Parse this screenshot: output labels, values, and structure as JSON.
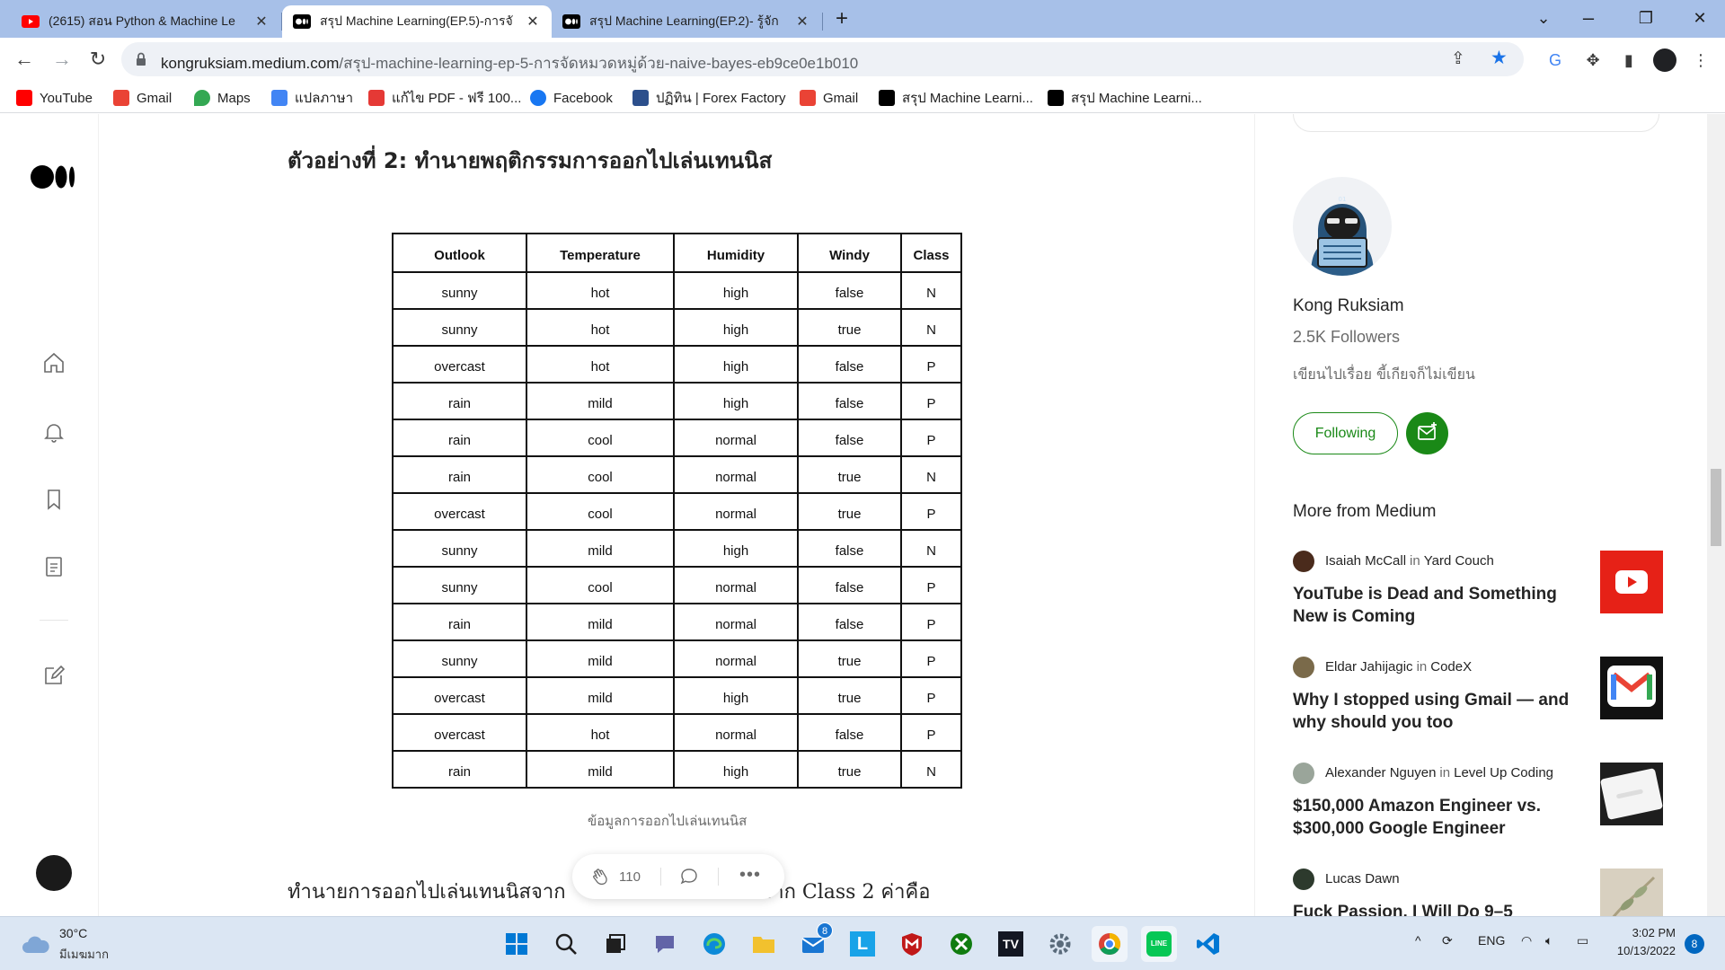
{
  "browser": {
    "tabs": [
      {
        "title": "(2615) สอน Python & Machine Le",
        "favicon": "youtube-icon",
        "active": false
      },
      {
        "title": "สรุป Machine Learning(EP.5)-การจั",
        "favicon": "medium-icon",
        "active": true
      },
      {
        "title": "สรุป Machine Learning(EP.2)- รู้จัก",
        "favicon": "medium-icon",
        "active": false
      }
    ],
    "url_host": "kongruksiam.medium.com",
    "url_path": "/สรุป-machine-learning-ep-5-การจัดหมวดหมู่ด้วย-naive-bayes-eb9ce0e1b010",
    "bookmarks": [
      {
        "label": "YouTube",
        "icon": "youtube-icon",
        "color": "#ff0000"
      },
      {
        "label": "Gmail",
        "icon": "gmail-icon",
        "color": "#ea4335"
      },
      {
        "label": "Maps",
        "icon": "maps-icon",
        "color": "#34a853"
      },
      {
        "label": "แปลภาษา",
        "icon": "translate-icon",
        "color": "#4285f4"
      },
      {
        "label": "แก้ไข PDF - ฟรี 100...",
        "icon": "pdf-icon",
        "color": "#e53935"
      },
      {
        "label": "Facebook",
        "icon": "facebook-icon",
        "color": "#1877f2"
      },
      {
        "label": "ปฏิทิน | Forex Factory",
        "icon": "calendar-icon",
        "color": "#2c4f8c"
      },
      {
        "label": "Gmail",
        "icon": "gmail-icon",
        "color": "#ea4335"
      },
      {
        "label": "สรุป Machine Learni...",
        "icon": "medium-icon",
        "color": "#000000"
      },
      {
        "label": "สรุป Machine Learni...",
        "icon": "medium-icon",
        "color": "#000000"
      }
    ]
  },
  "article": {
    "heading": "ตัวอย่างที่ 2: ทำนายพฤติกรรมการออกไปเล่นเทนนิส",
    "table_headers": [
      "Outlook",
      "Temperature",
      "Humidity",
      "Windy",
      "Class"
    ],
    "table_rows": [
      [
        "sunny",
        "hot",
        "high",
        "false",
        "N"
      ],
      [
        "sunny",
        "hot",
        "high",
        "true",
        "N"
      ],
      [
        "overcast",
        "hot",
        "high",
        "false",
        "P"
      ],
      [
        "rain",
        "mild",
        "high",
        "false",
        "P"
      ],
      [
        "rain",
        "cool",
        "normal",
        "false",
        "P"
      ],
      [
        "rain",
        "cool",
        "normal",
        "true",
        "N"
      ],
      [
        "overcast",
        "cool",
        "normal",
        "true",
        "P"
      ],
      [
        "sunny",
        "mild",
        "high",
        "false",
        "N"
      ],
      [
        "sunny",
        "cool",
        "normal",
        "false",
        "P"
      ],
      [
        "rain",
        "mild",
        "normal",
        "false",
        "P"
      ],
      [
        "sunny",
        "mild",
        "normal",
        "true",
        "P"
      ],
      [
        "overcast",
        "mild",
        "high",
        "true",
        "P"
      ],
      [
        "overcast",
        "hot",
        "normal",
        "false",
        "P"
      ],
      [
        "rain",
        "mild",
        "high",
        "true",
        "N"
      ]
    ],
    "caption": "ข้อมูลการออกไปเล่นเทนนิส",
    "body_line": "ทำนายการออกไปเล่นเทนนิสจาก",
    "body_line_end": "ผลลัพธ์จาก Class 2 ค่าคือ",
    "clap_count": "110"
  },
  "sidebar": {
    "author_name": "Kong Ruksiam",
    "followers": "2.5K Followers",
    "bio": "เขียนไปเรื่อย ขี้เกียจก็ไม่เขียน",
    "follow_label": "Following",
    "more_from": "More from Medium",
    "cards": [
      {
        "author": "Isaiah McCall",
        "in": "in",
        "pub": "Yard Couch",
        "title": "YouTube is Dead and Something New is Coming",
        "thumb": "youtube-icon"
      },
      {
        "author": "Eldar Jahijagic",
        "in": "in",
        "pub": "CodeX",
        "title": "Why I stopped using Gmail — and why should you too",
        "thumb": "gmail-icon"
      },
      {
        "author": "Alexander Nguyen",
        "in": "in",
        "pub": "Level Up Coding",
        "title": "$150,000 Amazon Engineer vs. $300,000 Google Engineer",
        "thumb": "google-phone-image"
      },
      {
        "author": "Lucas Dawn",
        "in": "",
        "pub": "",
        "title": "Fuck Passion, I Will Do 9–5",
        "thumb": "plant-image"
      }
    ]
  },
  "taskbar": {
    "temp": "30°C",
    "condition": "มีเมฆมาก",
    "lang": "ENG",
    "time": "3:02 PM",
    "date": "10/13/2022",
    "notif_count": "8",
    "mail_badge": "8"
  },
  "colors": {
    "tabbar": "#a7c0e8",
    "accent_green": "#1a8917",
    "taskbar": "#dbe6f3"
  }
}
